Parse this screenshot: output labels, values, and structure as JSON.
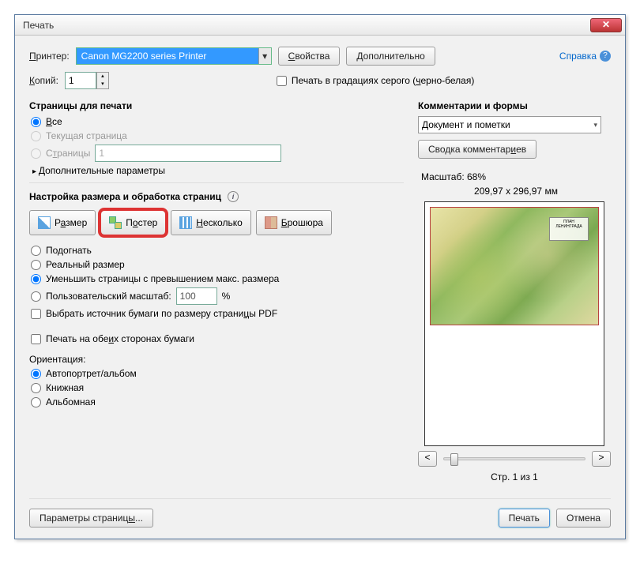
{
  "title": "Печать",
  "printer": {
    "label": "Принтер:",
    "value": "Canon MG2200 series Printer",
    "properties_btn": "Свойства",
    "advanced_btn": "Дополнительно"
  },
  "copies": {
    "label": "Копий:",
    "value": "1"
  },
  "grayscale": {
    "label": "Печать в градациях серого (черно-белая)"
  },
  "help": {
    "label": "Справка"
  },
  "pages_section": {
    "title": "Страницы для печати",
    "all": "Все",
    "current": "Текущая страница",
    "pages": "Страницы",
    "pages_value": "1",
    "more": "Дополнительные параметры"
  },
  "size_section": {
    "title": "Настройка размера и обработка страниц",
    "btn_size": "Размер",
    "btn_poster": "Постер",
    "btn_multi": "Несколько",
    "btn_brochure": "Брошюра",
    "fit": "Подогнать",
    "actual": "Реальный размер",
    "shrink": "Уменьшить страницы с превышением макс. размера",
    "custom": "Пользовательский масштаб:",
    "custom_value": "100",
    "percent": "%",
    "paper_source": "Выбрать источник бумаги по размеру страницы PDF",
    "duplex": "Печать на обеих сторонах бумаги",
    "orientation_label": "Ориентация:",
    "orient_auto": "Автопортрет/альбом",
    "orient_portrait": "Книжная",
    "orient_landscape": "Альбомная"
  },
  "comments": {
    "title": "Комментарии и формы",
    "value": "Документ и пометки",
    "summary_btn": "Сводка комментариев"
  },
  "preview": {
    "scale_label": "Масштаб:  68%",
    "dims": "209,97 x 296,97 мм",
    "map_title": "ПЛАН ЛЕНИНГРАДА",
    "page_info": "Стр. 1 из 1",
    "prev": "<",
    "next": ">"
  },
  "footer": {
    "page_setup": "Параметры страницы...",
    "print": "Печать",
    "cancel": "Отмена"
  }
}
